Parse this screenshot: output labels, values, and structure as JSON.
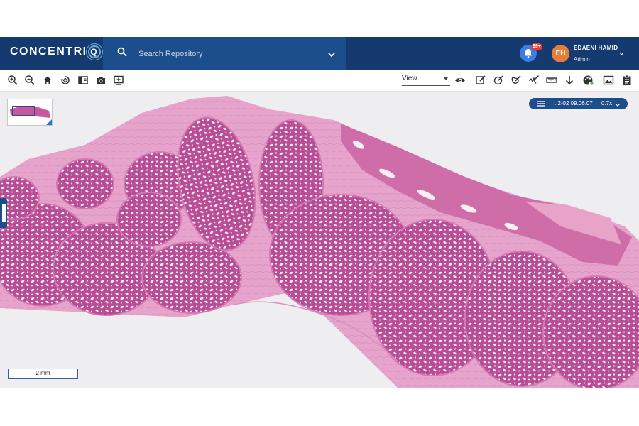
{
  "app": {
    "logo_text": "CONCENTRI",
    "logo_q": "Q",
    "brand_color": "#143a70",
    "accent_color": "#3c7de0"
  },
  "search": {
    "placeholder": "Search Repository",
    "icon": "search-icon"
  },
  "notifications": {
    "badge": "99+",
    "icon": "bell-icon"
  },
  "user": {
    "initials": "EH",
    "name": "EDAENI HAMID",
    "role": "Admin"
  },
  "toolbar": {
    "left_icons": [
      "zoom-in-icon",
      "zoom-out-icon",
      "home-icon",
      "rotate-icon",
      "split-view-icon",
      "camera-icon",
      "add-slide-icon"
    ],
    "view_select": "View",
    "right_icons": [
      "eye-icon",
      "annotate-icon",
      "measure-circle-icon",
      "measure-angle-icon",
      "freehand-icon",
      "ruler-icon",
      "download-icon",
      "palette-icon",
      "image-icon",
      "clipboard-icon"
    ]
  },
  "viewer": {
    "slide_name": "..2-02 09.06.07",
    "zoom": "0.7x",
    "scale_label": "2 mm",
    "tissue_color": "#c9579e"
  }
}
